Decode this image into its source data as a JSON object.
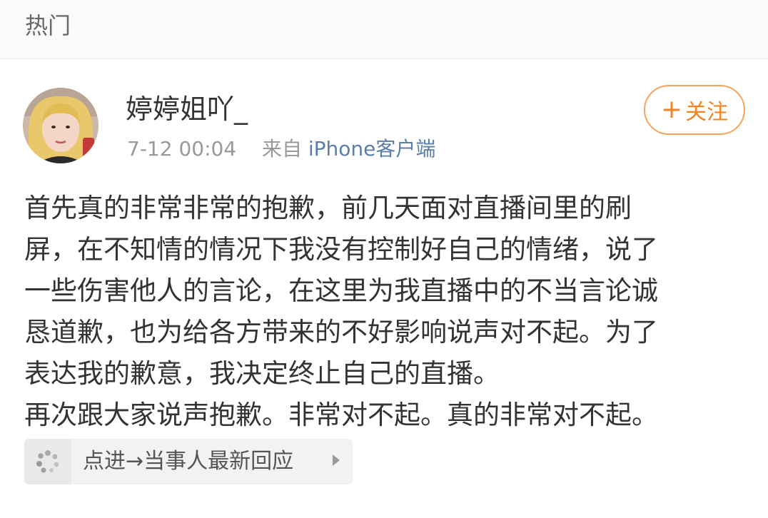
{
  "header": {
    "title": "热门"
  },
  "post": {
    "username": "婷婷姐吖_",
    "time": "7-12 00:04",
    "source_prefix": "来自",
    "source": "iPhone客户端",
    "follow": {
      "plus": "+",
      "label": "关注"
    },
    "body_lines": [
      "首先真的非常非常的抱歉，前几天面对直播间里的刷",
      "屏，在不知情的情况下我没有控制好自己的情绪，说了",
      "一些伤害他人的言论，在这里为我直播中的不当言论诚",
      "恳道歉，也为给各方带来的不好影响说声对不起。为了",
      "表达我的歉意，我决定终止自己的直播。",
      "再次跟大家说声抱歉。非常对不起。真的非常对不起。"
    ],
    "link_card": {
      "label": "点进→当事人最新回应",
      "icon": "loading-dots-icon"
    }
  },
  "colors": {
    "follow_border": "#f7a35a",
    "follow_text": "#f28422",
    "source_link": "#5b7ea8"
  }
}
